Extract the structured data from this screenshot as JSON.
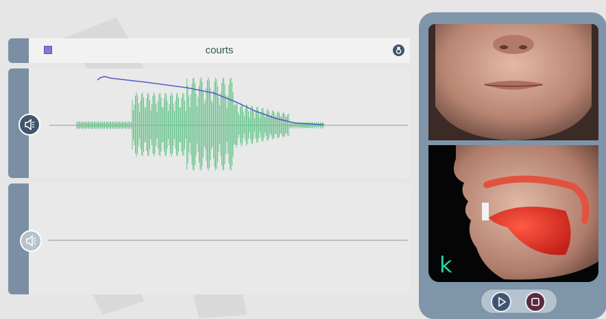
{
  "word": "courts",
  "phoneme": "k",
  "colors": {
    "waveform": "#68c48c",
    "pitch": "#5b55c8",
    "panel": "#7f95a9",
    "accent": "#3e5670",
    "phoneme": "#22d7a5"
  },
  "icons": {
    "header_left": "stop-square-icon",
    "header_right": "badge-icon",
    "track1_speaker": "speaker-icon",
    "track2_speaker": "speaker-icon",
    "play": "play-icon",
    "stop": "stop-icon"
  }
}
